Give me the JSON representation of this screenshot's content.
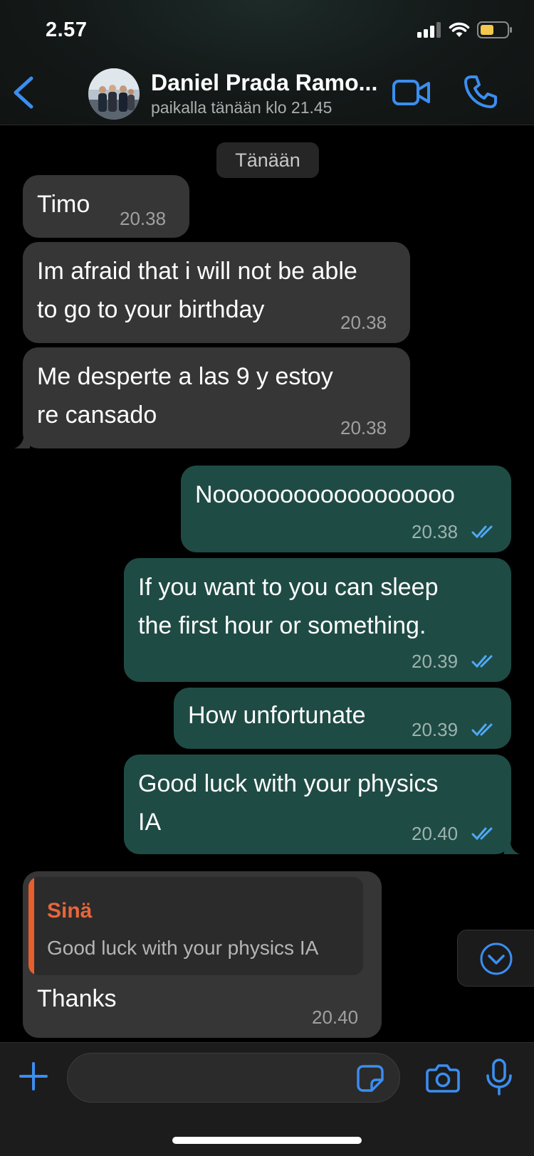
{
  "status_bar": {
    "time": "2.57"
  },
  "header": {
    "contact_name": "Daniel Prada Ramo...",
    "last_seen": "paikalla tänään klo 21.45"
  },
  "date_separator": "Tänään",
  "messages": [
    {
      "direction": "in",
      "text": "Timo",
      "time": "20.38"
    },
    {
      "direction": "in",
      "text": "Im afraid that i will not be able\nto go to your birthday",
      "time": "20.38"
    },
    {
      "direction": "in",
      "text": "Me desperte a las 9 y estoy\nre cansado",
      "time": "20.38"
    },
    {
      "direction": "out",
      "text": "Noooooooooooooooooo",
      "time": "20.38",
      "status": "read"
    },
    {
      "direction": "out",
      "text": "If you want to you can sleep\nthe first hour or something.",
      "time": "20.39",
      "status": "read"
    },
    {
      "direction": "out",
      "text": "How unfortunate",
      "time": "20.39",
      "status": "read"
    },
    {
      "direction": "out",
      "text": "Good luck with your physics\nIA",
      "time": "20.40",
      "status": "read"
    },
    {
      "direction": "in",
      "text": "Thanks",
      "time": "20.40",
      "reply_to": {
        "author": "Sinä",
        "text": "Good luck with your physics IA"
      }
    }
  ],
  "input": {
    "placeholder": "",
    "value": ""
  },
  "icons": {
    "back": "chevron-left-icon",
    "video": "video-camera-icon",
    "call": "phone-icon",
    "scroll": "chevron-down-circle-icon",
    "attach": "plus-icon",
    "sticker": "sticker-icon",
    "camera": "camera-icon",
    "mic": "microphone-icon"
  },
  "colors": {
    "accent": "#3b8ef0",
    "outgoing_bubble": "#1f4b45",
    "incoming_bubble": "#363636",
    "reply_author": "#e8663a",
    "read_ticks": "#4fa9f5",
    "battery": "#f2c94c"
  }
}
